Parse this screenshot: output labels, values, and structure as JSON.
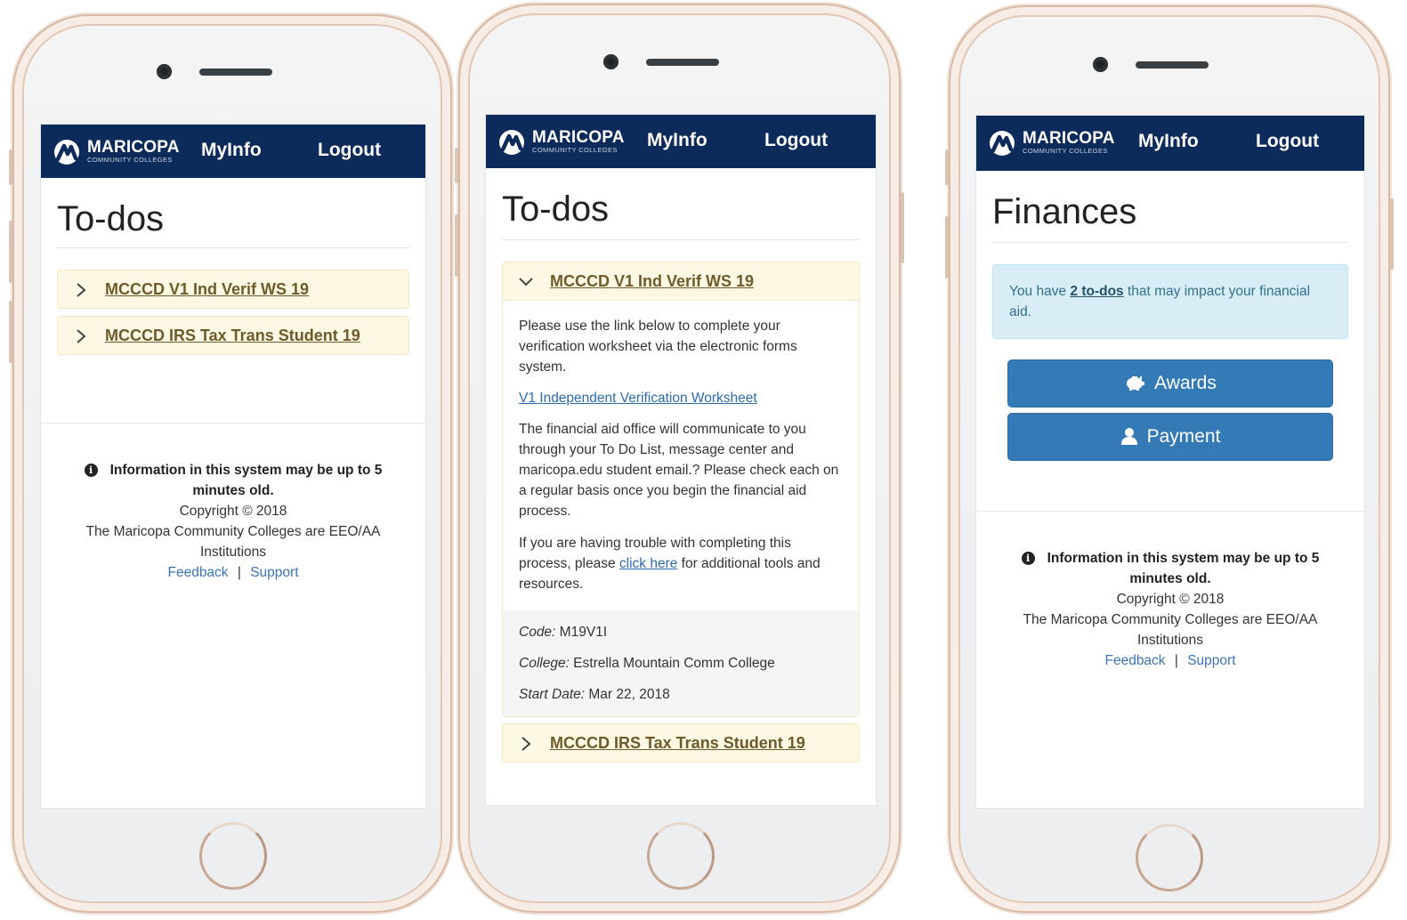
{
  "navbar": {
    "logo_word": "MARICOPA",
    "logo_sub": "COMMUNITY COLLEGES",
    "myinfo": "MyInfo",
    "logout": "Logout",
    "bg_color": "#0c2a5a"
  },
  "phone1": {
    "title": "To-dos",
    "items": [
      {
        "label": "MCCCD V1 Ind Verif WS 19",
        "icon": "chevron-right-icon"
      },
      {
        "label": "MCCCD IRS Tax Trans Student 19",
        "icon": "chevron-right-icon"
      }
    ]
  },
  "phone2": {
    "title": "To-dos",
    "expanded": {
      "label": "MCCCD V1 Ind Verif WS 19",
      "icon": "chevron-down-icon",
      "p1": "Please use the link below to complete your verification worksheet via the electronic forms system.",
      "worksheet_link": "V1 Independent Verification Worksheet",
      "p2": "The financial aid office will communicate to you through your To Do List, message center and maricopa.edu student email.? Please check each on a regular basis once you begin the financial aid process.",
      "p3_before": "If you are having trouble with completing this process, please ",
      "p3_link": "click here",
      "p3_after": " for additional tools and resources.",
      "code_label": "Code:",
      "code_value": " M19V1I",
      "college_label": "College:",
      "college_value": " Estrella Mountain Comm College",
      "start_label": "Start Date:",
      "start_value": " Mar 22, 2018"
    },
    "collapsed": {
      "label": "MCCCD IRS Tax Trans Student 19",
      "icon": "chevron-right-icon"
    }
  },
  "phone3": {
    "title": "Finances",
    "alert_before": "You have ",
    "alert_link": "2 to-dos",
    "alert_after": " that may impact your financial aid.",
    "awards": "Awards",
    "payment": "Payment"
  },
  "footer": {
    "info_line": "Information in this system may be up to 5 minutes old.",
    "copyright": "Copyright © 2018",
    "eeo": "The Maricopa Community Colleges are EEO/AA Institutions",
    "feedback": "Feedback",
    "separator": "|",
    "support": "Support"
  }
}
